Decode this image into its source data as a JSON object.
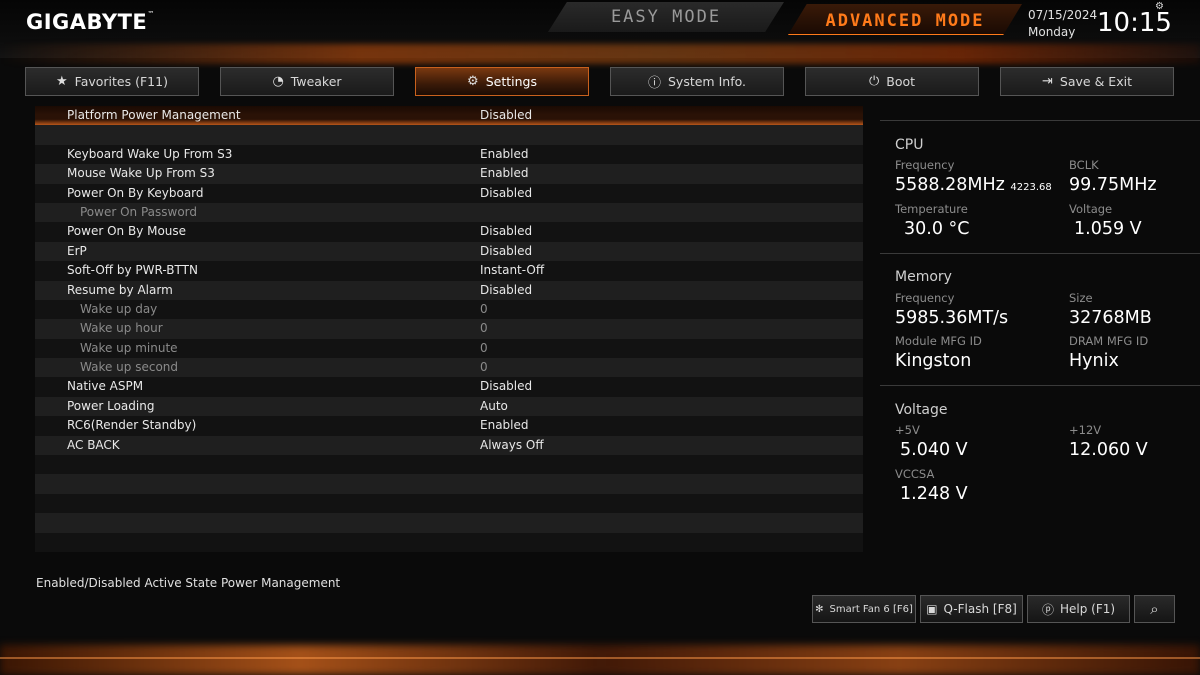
{
  "header": {
    "brand": "GIGABYTE",
    "brand_tm": "™",
    "easy_mode": "EASY MODE",
    "advanced_mode": "ADVANCED MODE",
    "date": "07/15/2024",
    "weekday": "Monday",
    "time": "10:15",
    "settings_glyph": "⚙"
  },
  "tabs": [
    {
      "label": "Favorites (F11)",
      "icon": "star-icon",
      "glyph": "★"
    },
    {
      "label": "Tweaker",
      "icon": "speedometer-icon",
      "glyph": "◔"
    },
    {
      "label": "Settings",
      "icon": "gear-icon",
      "glyph": "⚙"
    },
    {
      "label": "System Info.",
      "icon": "info-icon",
      "glyph": "ⓘ"
    },
    {
      "label": "Boot",
      "icon": "power-icon",
      "glyph": "⏻"
    },
    {
      "label": "Save & Exit",
      "icon": "exit-icon",
      "glyph": "⇥"
    }
  ],
  "settings": [
    {
      "label": "Platform Power Management",
      "value": "Disabled"
    },
    {
      "label": "",
      "value": ""
    },
    {
      "label": "Keyboard Wake Up From S3",
      "value": "Enabled"
    },
    {
      "label": "Mouse Wake Up From S3",
      "value": "Enabled"
    },
    {
      "label": "Power On By Keyboard",
      "value": "Disabled"
    },
    {
      "label": "Power On Password",
      "value": ""
    },
    {
      "label": "Power On By Mouse",
      "value": "Disabled"
    },
    {
      "label": "ErP",
      "value": "Disabled"
    },
    {
      "label": "Soft-Off by PWR-BTTN",
      "value": "Instant-Off"
    },
    {
      "label": "Resume by Alarm",
      "value": "Disabled"
    },
    {
      "label": "Wake up day",
      "value": "0"
    },
    {
      "label": "Wake up hour",
      "value": "0"
    },
    {
      "label": "Wake up minute",
      "value": "0"
    },
    {
      "label": "Wake up second",
      "value": "0"
    },
    {
      "label": "Native ASPM",
      "value": "Disabled"
    },
    {
      "label": "Power Loading",
      "value": "Auto"
    },
    {
      "label": "RC6(Render Standby)",
      "value": "Enabled"
    },
    {
      "label": "AC BACK",
      "value": "Always Off"
    }
  ],
  "info": {
    "cpu": {
      "title": "CPU",
      "frequency_label": "Frequency",
      "frequency": "5588.28MHz",
      "frequency_sub": "4223.68",
      "bclk_label": "BCLK",
      "bclk": "99.75MHz",
      "temperature_label": "Temperature",
      "temperature": "30.0 °C",
      "voltage_label": "Voltage",
      "voltage": "1.059 V"
    },
    "memory": {
      "title": "Memory",
      "frequency_label": "Frequency",
      "frequency": "5985.36MT/s",
      "size_label": "Size",
      "size": "32768MB",
      "module_label": "Module MFG ID",
      "module": "Kingston",
      "dram_label": "DRAM MFG ID",
      "dram": "Hynix"
    },
    "voltage": {
      "title": "Voltage",
      "p5v_label": "+5V",
      "p5v": "5.040 V",
      "p12v_label": "+12V",
      "p12v": "12.060 V",
      "vccsa_label": "VCCSA",
      "vccsa": "1.248 V"
    }
  },
  "help_text": "Enabled/Disabled Active State Power Management",
  "bottom": {
    "smartfan": "Smart Fan 6 [F6]",
    "qflash": "Q-Flash [F8]",
    "help": "Help (F1)"
  }
}
